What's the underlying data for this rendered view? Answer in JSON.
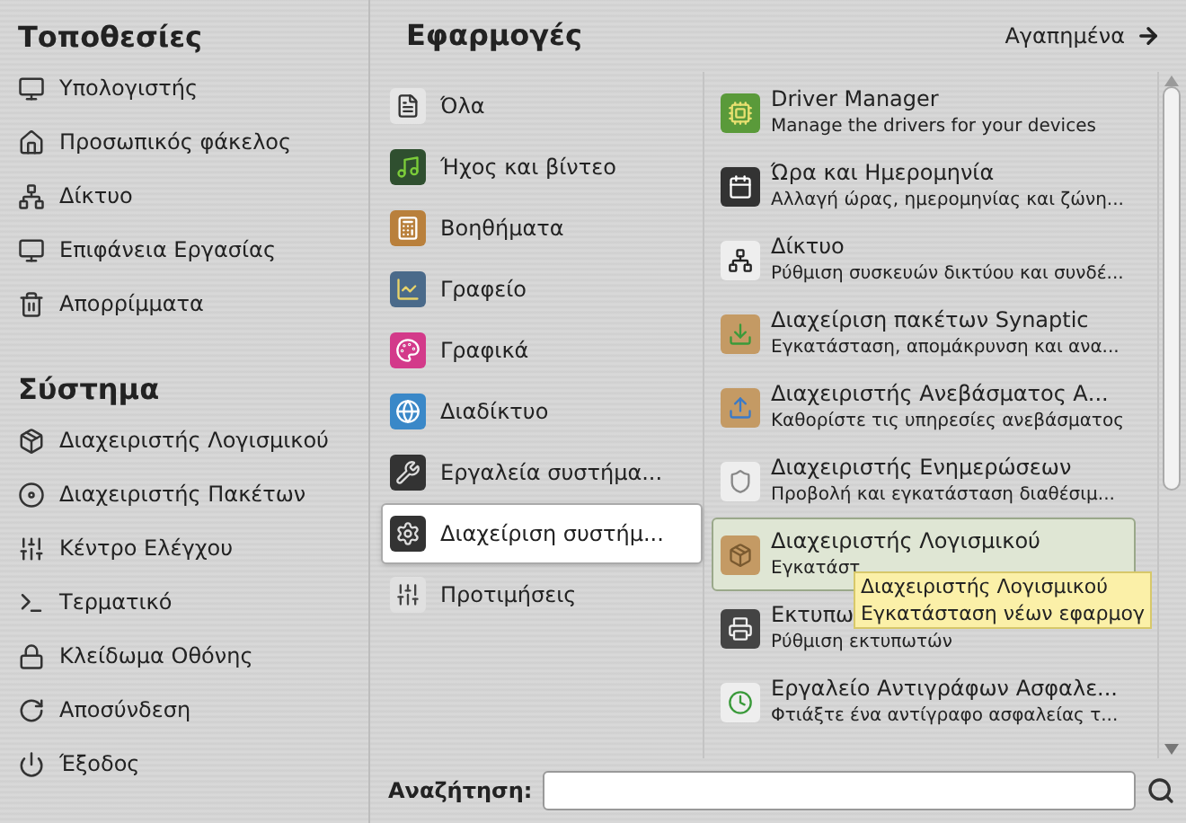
{
  "places": {
    "title": "Τοποθεσίες",
    "items": [
      "Υπολογιστής",
      "Προσωπικός φάκελος",
      "Δίκτυο",
      "Επιφάνεια Εργασίας",
      "Απορρίμματα"
    ]
  },
  "system": {
    "title": "Σύστημα",
    "items": [
      "Διαχειριστής Λογισμικού",
      "Διαχειριστής Πακέτων",
      "Κέντρο Ελέγχου",
      "Τερματικό",
      "Κλείδωμα Οθόνης",
      "Αποσύνδεση",
      "Έξοδος"
    ]
  },
  "applications": {
    "title": "Εφαρμογές",
    "favorites": "Αγαπημένα",
    "categories": [
      {
        "label": "Όλα",
        "selected": false
      },
      {
        "label": "Ήχος και βίντεο",
        "selected": false
      },
      {
        "label": "Βοηθήματα",
        "selected": false
      },
      {
        "label": "Γραφείο",
        "selected": false
      },
      {
        "label": "Γραφικά",
        "selected": false
      },
      {
        "label": "Διαδίκτυο",
        "selected": false
      },
      {
        "label": "Εργαλεία συστήμα...",
        "selected": false
      },
      {
        "label": "Διαχείριση συστήμ...",
        "selected": true
      },
      {
        "label": "Προτιμήσεις",
        "selected": false
      }
    ],
    "apps": [
      {
        "name": "Driver Manager",
        "description": "Manage the drivers for your devices",
        "selected": false
      },
      {
        "name": "Ώρα και Ημερομηνία",
        "description": "Αλλαγή ώρας, ημερομηνίας και ζώνη...",
        "selected": false
      },
      {
        "name": "Δίκτυο",
        "description": "Ρύθμιση συσκευών δικτύου και συνδέ...",
        "selected": false
      },
      {
        "name": "Διαχείριση πακέτων Synaptic",
        "description": "Εγκατάσταση, απομάκρυνση και ανα...",
        "selected": false
      },
      {
        "name": "Διαχειριστής Ανεβάσματος Α...",
        "description": "Καθορίστε τις υπηρεσίες ανεβάσματος",
        "selected": false
      },
      {
        "name": "Διαχειριστής Ενημερώσεων",
        "description": "Προβολή και εγκατάσταση διαθέσιμ...",
        "selected": false
      },
      {
        "name": "Διαχειριστής Λογισμικού",
        "description": "Εγκατάστ",
        "selected": true
      },
      {
        "name": "Εκτυπω",
        "description": "Ρύθμιση εκτυπωτών",
        "selected": false
      },
      {
        "name": "Εργαλείο Αντιγράφων Ασφαλε...",
        "description": "Φτιάξτε ένα αντίγραφο ασφαλείας τ...",
        "selected": false
      }
    ],
    "tooltip": {
      "title": "Διαχειριστής Λογισμικού",
      "text": "Εγκατάσταση νέων εφαρμογ"
    }
  },
  "search": {
    "label": "Αναζήτηση:"
  }
}
